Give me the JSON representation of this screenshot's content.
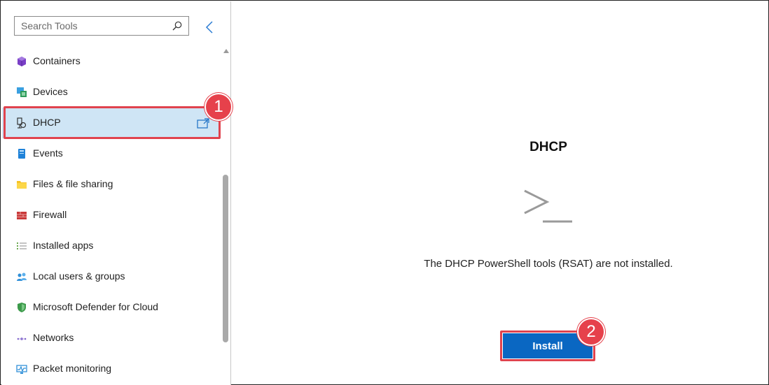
{
  "sidebar": {
    "search": {
      "placeholder": "Search Tools",
      "value": ""
    },
    "collapse_icon": "chevron-left-icon",
    "items": [
      {
        "label": "Containers",
        "icon": "containers-icon",
        "selected": false
      },
      {
        "label": "Devices",
        "icon": "devices-icon",
        "selected": false
      },
      {
        "label": "DHCP",
        "icon": "dhcp-icon",
        "selected": true
      },
      {
        "label": "Events",
        "icon": "events-icon",
        "selected": false
      },
      {
        "label": "Files & file sharing",
        "icon": "folder-icon",
        "selected": false
      },
      {
        "label": "Firewall",
        "icon": "firewall-icon",
        "selected": false
      },
      {
        "label": "Installed apps",
        "icon": "list-icon",
        "selected": false
      },
      {
        "label": "Local users & groups",
        "icon": "users-icon",
        "selected": false
      },
      {
        "label": "Microsoft Defender for Cloud",
        "icon": "shield-icon",
        "selected": false
      },
      {
        "label": "Networks",
        "icon": "network-icon",
        "selected": false
      },
      {
        "label": "Packet monitoring",
        "icon": "packet-monitor-icon",
        "selected": false
      }
    ]
  },
  "callouts": {
    "step1": "1",
    "step2": "2"
  },
  "main": {
    "title": "DHCP",
    "icon": "powershell-prompt-icon",
    "message": "The DHCP PowerShell tools (RSAT) are not installed.",
    "install_label": "Install"
  },
  "colors": {
    "selected_bg": "#cfe5f5",
    "accent": "#0a67c2",
    "callout": "#e6414b"
  }
}
